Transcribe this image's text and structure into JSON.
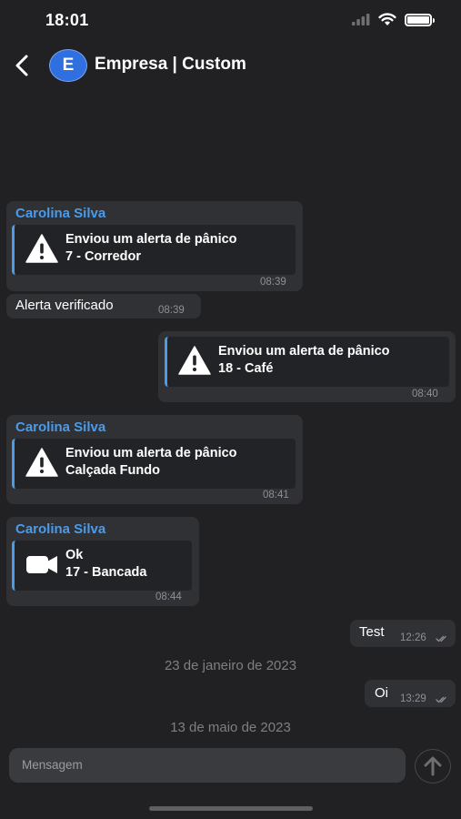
{
  "status": {
    "time": "18:01"
  },
  "header": {
    "avatar_letter": "E",
    "title": "Empresa | Custom"
  },
  "messages": [
    {
      "sender": "Carolina Silva",
      "title": "Enviou um alerta de pânico",
      "subtitle": "7 - Corredor",
      "time": "08:39",
      "icon": "warning-icon"
    },
    {
      "text": "Alerta verificado",
      "time": "08:39"
    },
    {
      "title": "Enviou um alerta de pânico",
      "subtitle": "18 - Café",
      "time": "08:40",
      "icon": "warning-icon"
    },
    {
      "sender": "Carolina Silva",
      "title": "Enviou um alerta de pânico",
      "subtitle": "Calçada Fundo",
      "time": "08:41",
      "icon": "warning-icon"
    },
    {
      "sender": "Carolina Silva",
      "title": "Ok",
      "subtitle": "17 - Bancada",
      "time": "08:44",
      "icon": "video-camera-icon"
    },
    {
      "text": "Test",
      "time": "12:26"
    },
    {
      "text": "Oi",
      "time": "13:29"
    }
  ],
  "date_separators": [
    "23 de janeiro de 2023",
    "13 de maio de 2023"
  ],
  "composer": {
    "placeholder": "Mensagem"
  },
  "colors": {
    "accent": "#4a9bea",
    "background": "#212124",
    "bubble": "#303135"
  }
}
